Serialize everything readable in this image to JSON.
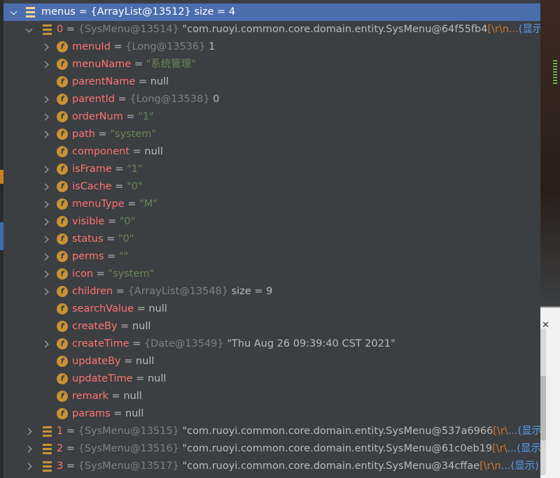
{
  "root": {
    "name": "menus",
    "ref": "{ArrayList@13512}",
    "extra": "size = 4"
  },
  "item0": {
    "index": "0",
    "ref": "{SysMenu@13514}",
    "value": "\"com.ruoyi.common.core.domain.entity.SysMenu@64f55fb4",
    "escape": "[\\r\\n...",
    "more": "(显示)"
  },
  "fields": [
    {
      "name": "menuId",
      "expandable": true,
      "ref": "{Long@13536}",
      "value": "1",
      "kind": "plain"
    },
    {
      "name": "menuName",
      "expandable": true,
      "ref": "",
      "value": "\"系统管理\"",
      "kind": "str"
    },
    {
      "name": "parentName",
      "expandable": false,
      "ref": "",
      "value": "null",
      "kind": "plain"
    },
    {
      "name": "parentId",
      "expandable": true,
      "ref": "{Long@13538}",
      "value": "0",
      "kind": "plain"
    },
    {
      "name": "orderNum",
      "expandable": true,
      "ref": "",
      "value": "\"1\"",
      "kind": "str"
    },
    {
      "name": "path",
      "expandable": true,
      "ref": "",
      "value": "\"system\"",
      "kind": "str"
    },
    {
      "name": "component",
      "expandable": false,
      "ref": "",
      "value": "null",
      "kind": "plain"
    },
    {
      "name": "isFrame",
      "expandable": true,
      "ref": "",
      "value": "\"1\"",
      "kind": "str"
    },
    {
      "name": "isCache",
      "expandable": true,
      "ref": "",
      "value": "\"0\"",
      "kind": "str"
    },
    {
      "name": "menuType",
      "expandable": true,
      "ref": "",
      "value": "\"M\"",
      "kind": "str"
    },
    {
      "name": "visible",
      "expandable": true,
      "ref": "",
      "value": "\"0\"",
      "kind": "str"
    },
    {
      "name": "status",
      "expandable": true,
      "ref": "",
      "value": "\"0\"",
      "kind": "str"
    },
    {
      "name": "perms",
      "expandable": true,
      "ref": "",
      "value": "\"\"",
      "kind": "str"
    },
    {
      "name": "icon",
      "expandable": true,
      "ref": "",
      "value": "\"system\"",
      "kind": "str"
    },
    {
      "name": "children",
      "expandable": true,
      "ref": "{ArrayList@13548}",
      "value": "size = 9",
      "kind": "plain"
    },
    {
      "name": "searchValue",
      "expandable": false,
      "ref": "",
      "value": "null",
      "kind": "plain"
    },
    {
      "name": "createBy",
      "expandable": false,
      "ref": "",
      "value": "null",
      "kind": "plain"
    },
    {
      "name": "createTime",
      "expandable": true,
      "ref": "{Date@13549}",
      "value": "\"Thu Aug 26 09:39:40 CST 2021\"",
      "kind": "plain"
    },
    {
      "name": "updateBy",
      "expandable": false,
      "ref": "",
      "value": "null",
      "kind": "plain"
    },
    {
      "name": "updateTime",
      "expandable": false,
      "ref": "",
      "value": "null",
      "kind": "plain"
    },
    {
      "name": "remark",
      "expandable": false,
      "ref": "",
      "value": "null",
      "kind": "plain"
    },
    {
      "name": "params",
      "expandable": false,
      "ref": "",
      "value": "null",
      "kind": "plain"
    }
  ],
  "siblings": [
    {
      "index": "1",
      "ref": "{SysMenu@13515}",
      "value": "\"com.ruoyi.common.core.domain.entity.SysMenu@537a6966",
      "escape": "[\\r\\",
      "more": "...(显示)"
    },
    {
      "index": "2",
      "ref": "{SysMenu@13516}",
      "value": "\"com.ruoyi.common.core.domain.entity.SysMenu@61c0eb19",
      "escape": "[\\r\\",
      "more": "...(显示)"
    },
    {
      "index": "3",
      "ref": "{SysMenu@13517}",
      "value": "\"com.ruoyi.common.core.domain.entity.SysMenu@34cffae",
      "escape": "[\\r\\n",
      "more": "...(显示)"
    }
  ],
  "colors": {
    "panel": "#3c3f41",
    "selection": "#4b6eaf",
    "field_name": "#ff7373",
    "string": "#6a8759",
    "ref": "#808080",
    "icon": "#c99236"
  }
}
